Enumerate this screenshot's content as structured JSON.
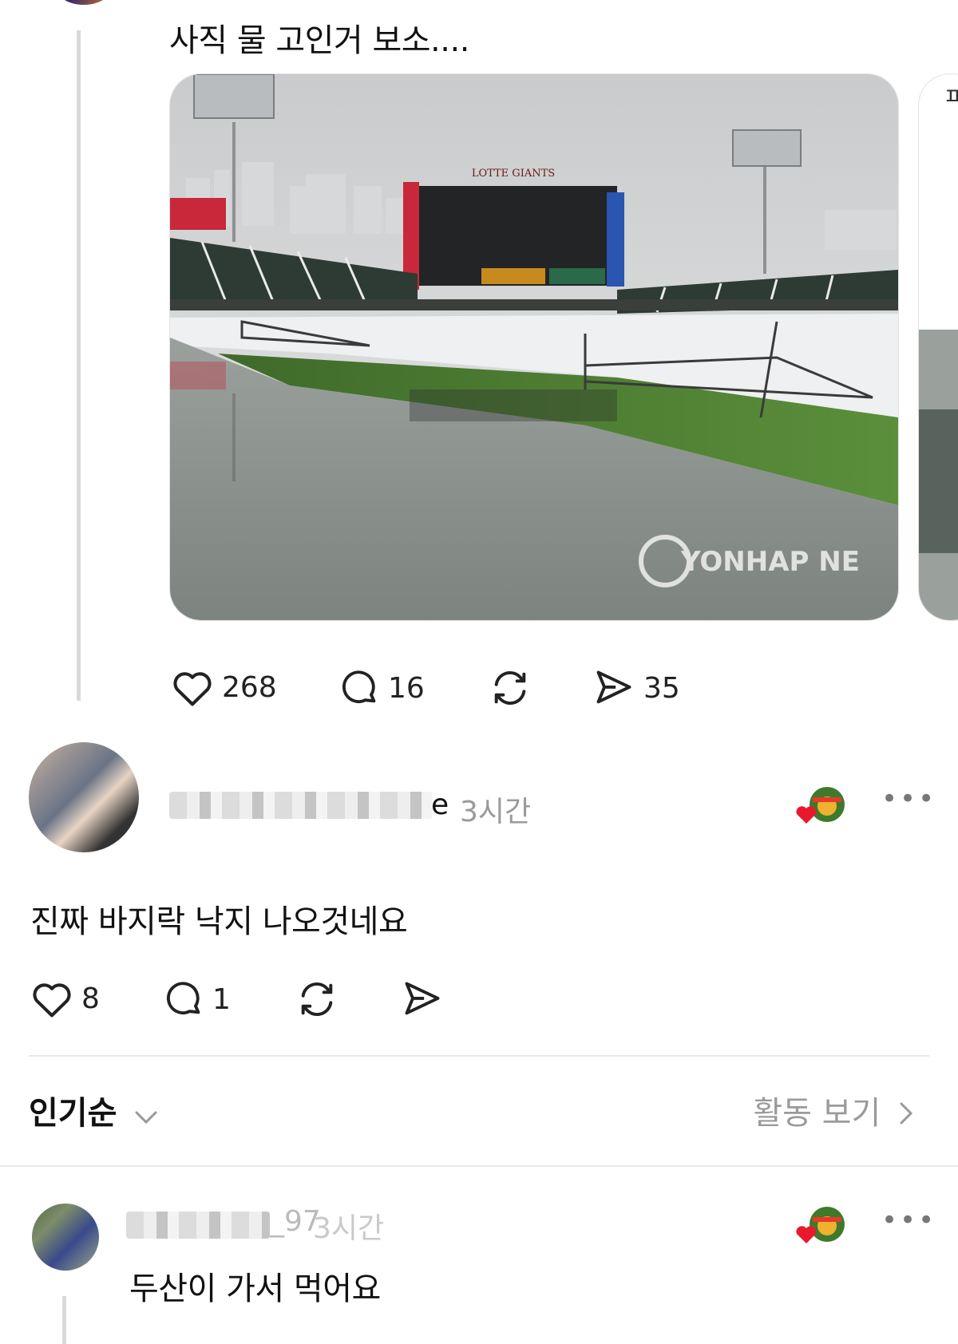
{
  "post": {
    "text": "사직 물 고인거 보소....",
    "photo_watermark": "YONHAP NE",
    "scoreboard_text": "LOTTE GIANTS",
    "likes": "268",
    "comments": "16",
    "shares": "35"
  },
  "reply": {
    "username_visible": "e",
    "time": "3시간",
    "text": "진짜 바지락 낙지 나오것네요",
    "likes": "8",
    "comments": "1"
  },
  "sort": {
    "label": "인기순",
    "activity_link": "활동 보기"
  },
  "reply2": {
    "username_visible": "_97",
    "time": "3시간",
    "text": "두산이 가서 먹어요"
  },
  "colors": {
    "heart": "#e8192c",
    "muted": "#9a9a9a",
    "grass": "#4a7f32",
    "water": "#8b928e"
  },
  "icons": [
    "heart-icon",
    "comment-icon",
    "repost-icon",
    "share-icon",
    "chevron-down-icon",
    "chevron-right-icon",
    "more-icon"
  ]
}
